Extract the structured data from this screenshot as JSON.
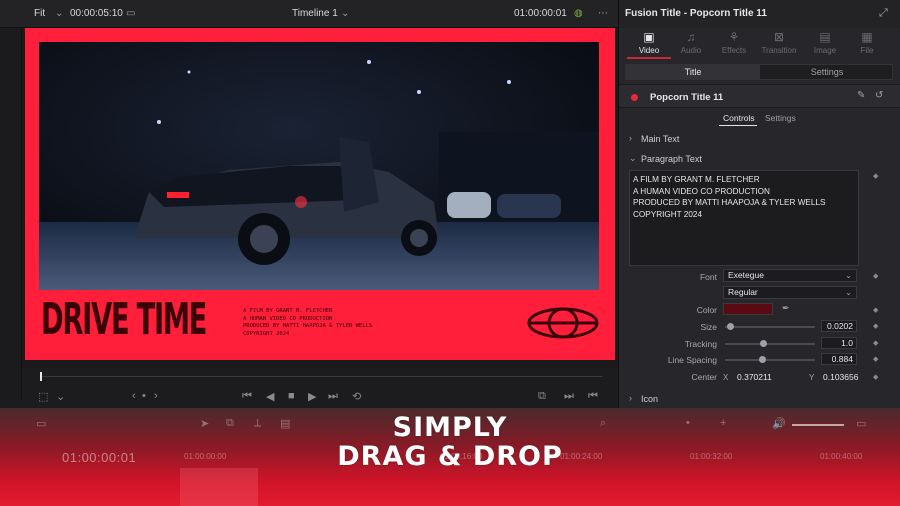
{
  "top_bar": {
    "zoom": "Fit",
    "timecode_left": "00:00:05:10",
    "timeline_name": "Timeline 1",
    "timecode_right": "01:00:00:01"
  },
  "frame": {
    "title": "DRIVE TIME",
    "credits": [
      "A FILM BY GRANT M. FLETCHER",
      "A HUMAN VIDEO CO PRODUCTION",
      "PRODUCED BY MATTI HAAPOJA & TYLER WELLS",
      "COPYRIGHT 2024"
    ]
  },
  "inspector": {
    "title": "Fusion Title - Popcorn Title 11",
    "tabs": [
      {
        "label": "Video",
        "icon": "film-icon"
      },
      {
        "label": "Audio",
        "icon": "music-icon"
      },
      {
        "label": "Effects",
        "icon": "wand-icon"
      },
      {
        "label": "Transition",
        "icon": "transition-icon"
      },
      {
        "label": "Image",
        "icon": "image-icon"
      },
      {
        "label": "File",
        "icon": "file-icon"
      }
    ],
    "segment": {
      "title": "Title",
      "settings": "Settings"
    },
    "node_name": "Popcorn Title 11",
    "sub_tabs": {
      "controls": "Controls",
      "settings": "Settings"
    },
    "sections": {
      "main_text": "Main Text",
      "paragraph_text": "Paragraph Text",
      "icon": "Icon"
    },
    "paragraph_lines": [
      "A FILM BY GRANT M. FLETCHER",
      "A HUMAN VIDEO CO PRODUCTION",
      "PRODUCED BY MATTI HAAPOJA & TYLER WELLS",
      "COPYRIGHT 2024"
    ],
    "font_label": "Font",
    "font_value": "Exetegue",
    "style_value": "Regular",
    "color_label": "Color",
    "color_value": "#5a0a12",
    "size_label": "Size",
    "size_value": "0.0202",
    "size_level": 0.05,
    "tracking_label": "Tracking",
    "tracking_value": "1.0",
    "tracking_level": 0.42,
    "line_spacing_label": "Line Spacing",
    "line_spacing_value": "0.884",
    "line_spacing_level": 0.41,
    "center_label": "Center",
    "x_label": "X",
    "x_value": "0.370211",
    "y_label": "Y",
    "y_value": "0.103656"
  },
  "bottom": {
    "timecode": "01:00:00:01",
    "ruler": [
      "01:00:00:00",
      "01:00:16:00",
      "01:00:24:00",
      "01:00:32:00",
      "01:00:40:00"
    ]
  },
  "overlay": {
    "line1": "SIMPLY",
    "line2": "DRAG & DROP"
  },
  "colors": {
    "accent": "#e8283c",
    "frame_red": "#ff1f3a"
  }
}
